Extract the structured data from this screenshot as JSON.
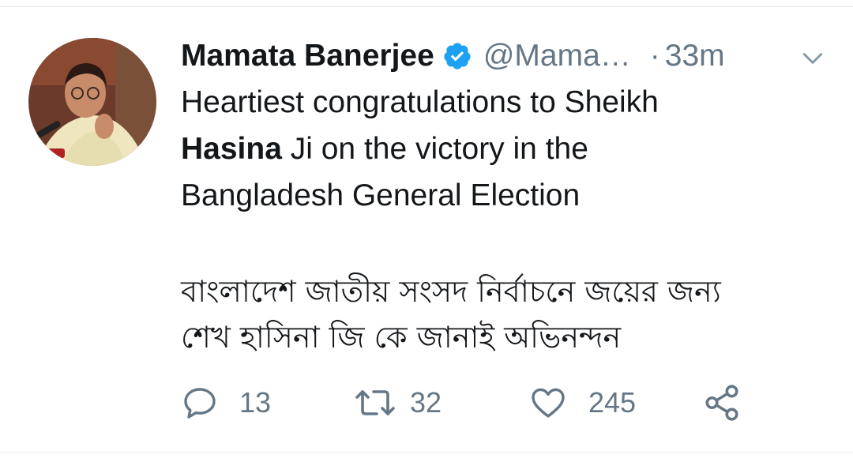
{
  "tweet": {
    "display_name": "Mamata Banerjee",
    "handle": "@Mama…",
    "separator": "·",
    "time": "33m",
    "text_line1": "Heartiest congratulations to Sheikh",
    "text_bold": "Hasina",
    "text_line2_rest": " Ji on the victory in the",
    "text_line3": "Bangladesh General Election",
    "bengali_line1": "বাংলাদেশ জাতীয় সংসদ নির্বাচনে জয়ের জন্য",
    "bengali_line2": "শেখ হাসিনা জি কে জানাই অভিনন্দন"
  },
  "actions": {
    "reply_count": "13",
    "retweet_count": "32",
    "like_count": "245"
  },
  "icons": {
    "verified": "verified-badge-icon",
    "chevron": "chevron-down-icon",
    "reply": "reply-icon",
    "retweet": "retweet-icon",
    "like": "heart-icon",
    "share": "share-icon"
  },
  "colors": {
    "verified_blue": "#1da1f2",
    "muted_gray": "#657786",
    "text": "#14171a"
  }
}
